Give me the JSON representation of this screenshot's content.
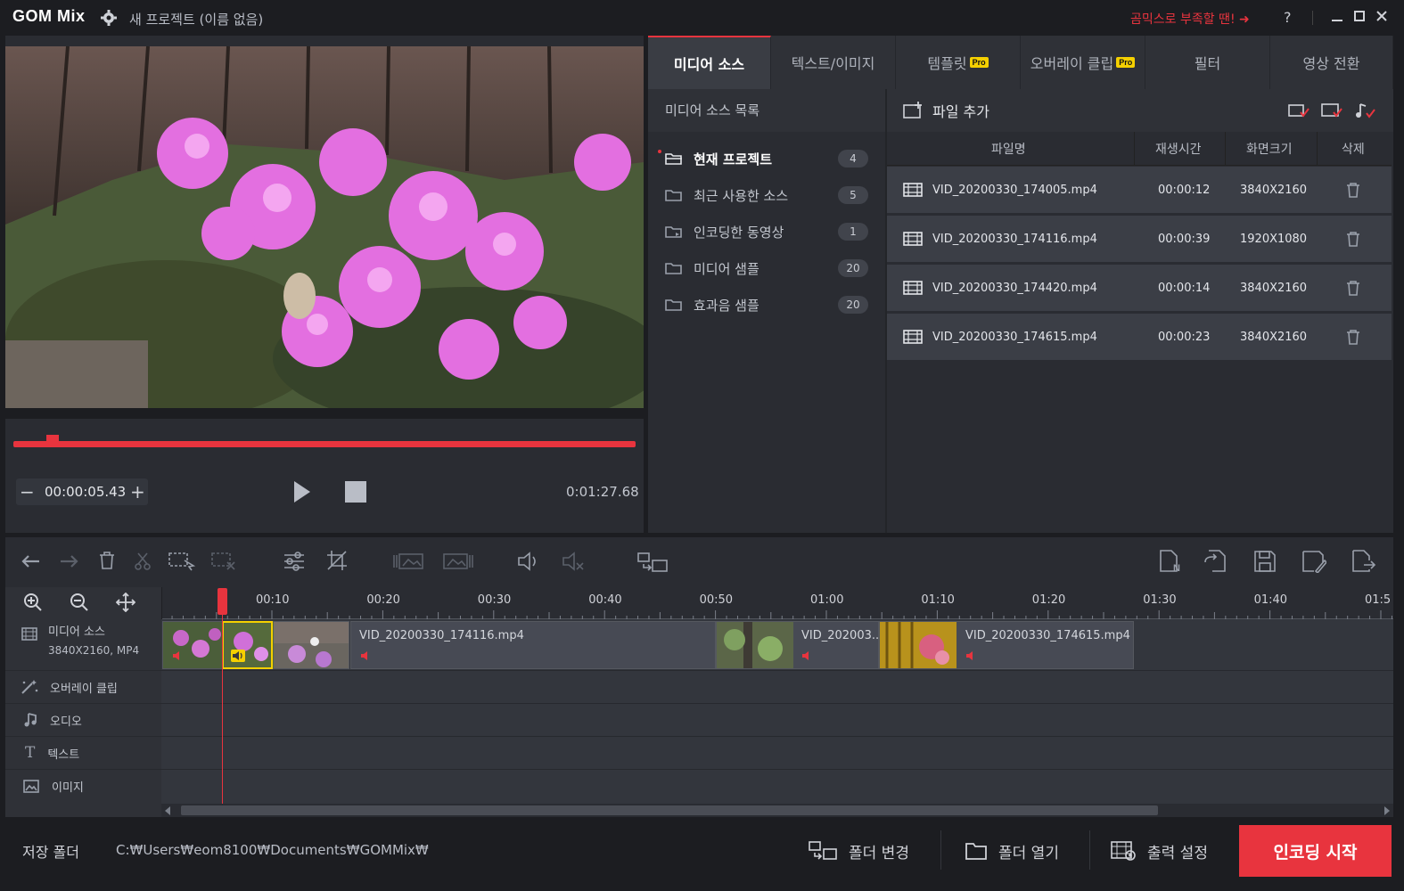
{
  "app": {
    "logo": "GOM Mix",
    "title": "새 프로젝트 (이름 없음)",
    "promo": "곰믹스로 부족할 땐! ➜",
    "help": "?"
  },
  "preview": {
    "current_time": "00:00:05.43",
    "total_time": "0:01:27.68",
    "minus": "−",
    "plus": "+"
  },
  "tabs": [
    {
      "label": "미디어 소스",
      "pro": ""
    },
    {
      "label": "텍스트/이미지",
      "pro": ""
    },
    {
      "label": "템플릿",
      "pro": "Pro"
    },
    {
      "label": "오버레이 클립",
      "pro": "Pro"
    },
    {
      "label": "필터",
      "pro": ""
    },
    {
      "label": "영상 전환",
      "pro": ""
    }
  ],
  "source_list": {
    "header": "미디어 소스 목록",
    "folders": [
      {
        "label": "현재 프로젝트",
        "count": "4"
      },
      {
        "label": "최근 사용한 소스",
        "count": "5"
      },
      {
        "label": "인코딩한 동영상",
        "count": "1"
      },
      {
        "label": "미디어 샘플",
        "count": "20"
      },
      {
        "label": "효과음 샘플",
        "count": "20"
      }
    ]
  },
  "files": {
    "add_label": "파일 추가",
    "columns": [
      "파일명",
      "재생시간",
      "화면크기",
      "삭제"
    ],
    "rows": [
      {
        "name": "VID_20200330_174005.mp4",
        "duration": "00:00:12",
        "size": "3840X2160"
      },
      {
        "name": "VID_20200330_174116.mp4",
        "duration": "00:00:39",
        "size": "1920X1080"
      },
      {
        "name": "VID_20200330_174420.mp4",
        "duration": "00:00:14",
        "size": "3840X2160"
      },
      {
        "name": "VID_20200330_174615.mp4",
        "duration": "00:00:23",
        "size": "3840X2160"
      }
    ]
  },
  "timeline": {
    "ruler": [
      "00:10",
      "00:20",
      "00:30",
      "00:40",
      "00:50",
      "01:00",
      "01:10",
      "01:20",
      "01:30",
      "01:40",
      "01:5"
    ],
    "tracks": [
      {
        "label": "미디어 소스",
        "sub": "3840X2160, MP4"
      },
      {
        "label": "오버레이 클립",
        "sub": ""
      },
      {
        "label": "오디오",
        "sub": ""
      },
      {
        "label": "텍스트",
        "sub": ""
      },
      {
        "label": "이미지",
        "sub": ""
      }
    ],
    "clips": [
      {
        "name": ""
      },
      {
        "name": ""
      },
      {
        "name": "VID_20200330_174116.mp4"
      },
      {
        "name": "VID_202003..."
      },
      {
        "name": "VID_20200330_174615.mp4"
      }
    ]
  },
  "bottom": {
    "save_folder_label": "저장 폴더",
    "save_path": "C:₩Users₩eom8100₩Documents₩GOMMix₩",
    "change_folder": "폴더 변경",
    "open_folder": "폴더 열기",
    "output_settings": "출력 설정",
    "encode_start": "인코딩 시작"
  },
  "colors": {
    "accent": "#e8343e",
    "pro_badge": "#f5d000"
  }
}
